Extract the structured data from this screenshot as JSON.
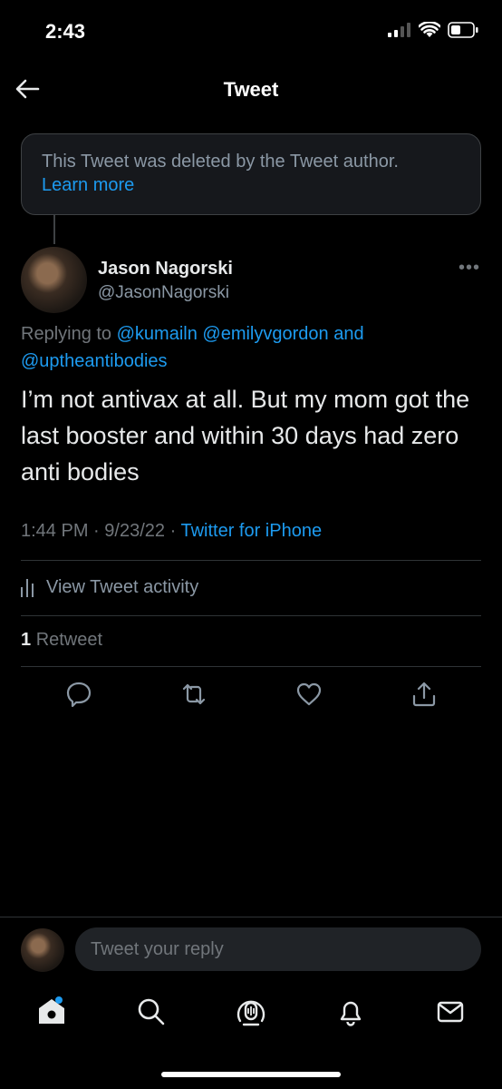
{
  "status_bar": {
    "time": "2:43"
  },
  "header": {
    "title": "Tweet"
  },
  "deleted_notice": {
    "text": "This Tweet was deleted by the Tweet author.",
    "link": "Learn more"
  },
  "tweet": {
    "author_name": "Jason Nagorski",
    "author_handle": "@JasonNagorski",
    "replying_prefix": "Replying to",
    "mention_1": "@kumailn",
    "mention_2": "@emilyvgordon",
    "replying_and": "and",
    "mention_3": "@uptheantibodies",
    "text": "I’m not antivax at all. But my mom got the last booster and within 30 days had zero anti bodies",
    "time": "1:44 PM",
    "date": "9/23/22",
    "source": "Twitter for iPhone",
    "separator": "·",
    "activity_label": "View Tweet activity",
    "retweet_count": "1",
    "retweet_label": "Retweet"
  },
  "reply": {
    "placeholder": "Tweet your reply"
  },
  "icons": [
    "back-arrow-icon",
    "more-icon",
    "activity-icon",
    "reply-icon",
    "retweet-icon",
    "like-icon",
    "share-icon",
    "home-icon",
    "search-icon",
    "spaces-icon",
    "notifications-icon",
    "messages-icon"
  ],
  "colors": {
    "background": "#000000",
    "accent": "#1d9bf0",
    "secondary_text": "#71767b"
  }
}
